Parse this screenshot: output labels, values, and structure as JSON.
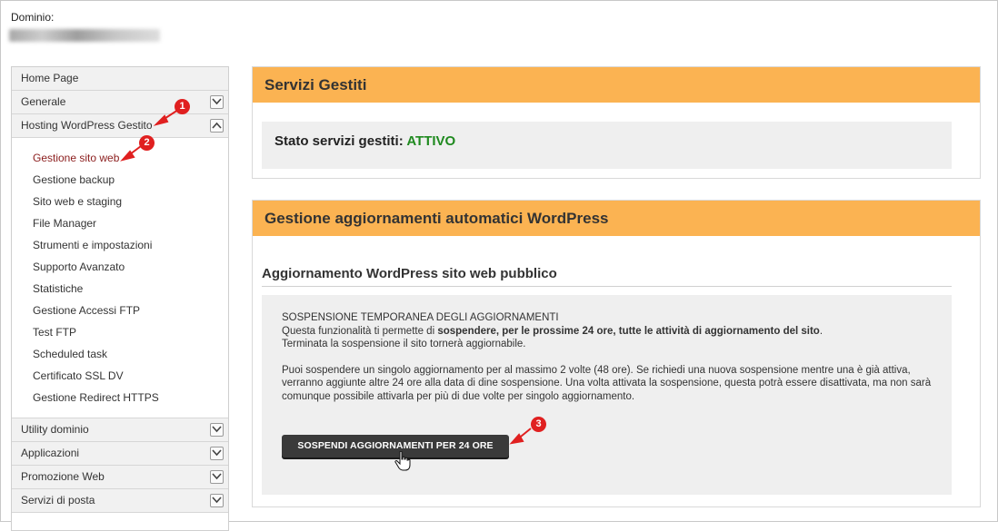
{
  "domain_label": "Dominio:",
  "sidebar": {
    "items_top": [
      {
        "label": "Home Page",
        "chevron": false
      },
      {
        "label": "Generale",
        "chevron": true,
        "chevron_dir": "down"
      },
      {
        "label": "Hosting WordPress Gestito",
        "chevron": true,
        "chevron_dir": "up"
      }
    ],
    "submenu": [
      {
        "label": "Gestione sito web",
        "active": true
      },
      {
        "label": "Gestione backup"
      },
      {
        "label": "Sito web e staging"
      },
      {
        "label": "File Manager"
      },
      {
        "label": "Strumenti e impostazioni"
      },
      {
        "label": "Supporto Avanzato"
      },
      {
        "label": "Statistiche"
      },
      {
        "label": "Gestione Accessi FTP"
      },
      {
        "label": "Test FTP"
      },
      {
        "label": "Scheduled task"
      },
      {
        "label": "Certificato SSL DV"
      },
      {
        "label": "Gestione Redirect HTTPS"
      }
    ],
    "items_bottom": [
      {
        "label": "Utility dominio"
      },
      {
        "label": "Applicazioni"
      },
      {
        "label": "Promozione Web"
      },
      {
        "label": "Servizi di posta"
      }
    ]
  },
  "services_panel": {
    "title": "Servizi Gestiti",
    "status_label": "Stato servizi gestiti:",
    "status_value": "ATTIVO",
    "status_color": "#1f8a1f"
  },
  "updates_panel": {
    "title": "Gestione aggiornamenti automatici WordPress",
    "section_title": "Aggiornamento WordPress sito web pubblico",
    "heading": "SOSPENSIONE TEMPORANEA DEGLI AGGIORNAMENTI",
    "line1_prefix": "Questa funzionalità ti permette di ",
    "line1_bold": "sospendere, per le prossime 24 ore, tutte le attività di aggiornamento del sito",
    "line1_suffix": ".",
    "line2": "Terminata la sospensione il sito tornerà aggiornabile.",
    "paragraph2": "Puoi sospendere un singolo aggiornamento per al massimo 2 volte (48 ore). Se richiedi una nuova sospensione mentre una è già attiva, verranno aggiunte altre 24 ore alla data di dine sospensione. Una volta attivata la sospensione, questa potrà essere disattivata, ma non sarà comunque possibile attivarla per più di due volte per singolo aggiornamento.",
    "button_label": "SOSPENDI AGGIORNAMENTI PER 24 ORE"
  },
  "markers": [
    "1",
    "2",
    "3"
  ],
  "colors": {
    "panel_header": "#fbb352",
    "marker": "#e02020",
    "active_link": "#8b1d1d"
  }
}
